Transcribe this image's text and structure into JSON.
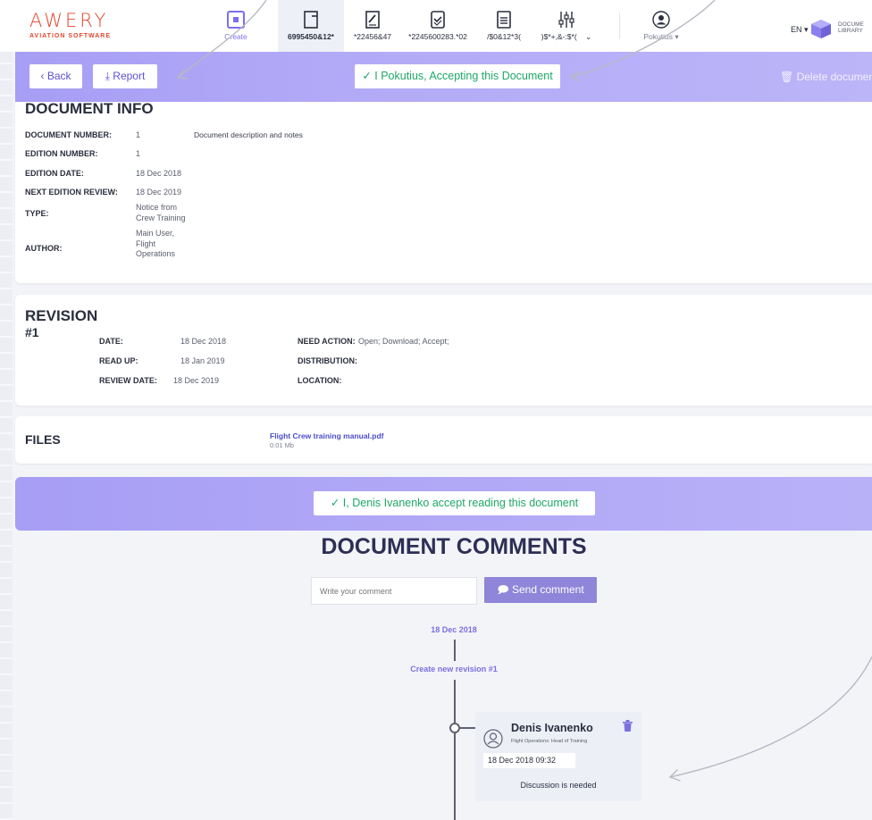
{
  "brand": {
    "name": "AWERY",
    "tagline": "AVIATION SOFTWARE",
    "accent": "#e3462c"
  },
  "nav": {
    "create_label": "Create",
    "items": [
      {
        "label": "6995450&12*",
        "icon": "document-icon"
      },
      {
        "label": "*22456&47",
        "icon": "edit-document-icon"
      },
      {
        "label": "*2245600283.*02",
        "icon": "checked-document-icon"
      },
      {
        "label": "/$0&12*3(",
        "icon": "list-document-icon"
      },
      {
        "label": ")$*+,&-:$*(",
        "icon": "sliders-icon"
      }
    ],
    "user_label": "Pokutius",
    "language": "EN",
    "library_text_line1": "DOCUME",
    "library_text_line2": "LIBRARY"
  },
  "action_bar": {
    "back_label": "Back",
    "report_label": "Report",
    "accept_label": "I Pokutius, Accepting this Document",
    "delete_label": "Delete documen"
  },
  "document_info": {
    "title": "DOCUMENT INFO",
    "description": "Document description and notes",
    "fields": [
      {
        "label": "DOCUMENT NUMBER:",
        "value": "1"
      },
      {
        "label": "EDITION NUMBER:",
        "value": "1"
      },
      {
        "label": "EDITION DATE:",
        "value": "18 Dec 2018"
      },
      {
        "label": "NEXT EDITION REVIEW:",
        "value": "18 Dec 2019"
      },
      {
        "label": "TYPE:",
        "value_lines": [
          "Notice from",
          "Crew Training"
        ]
      },
      {
        "label": "AUTHOR:",
        "value_lines": [
          "Main User,",
          "Flight",
          "Operations"
        ]
      }
    ]
  },
  "revision": {
    "title": "REVISION",
    "number": "#1",
    "date_label": "DATE:",
    "date_value": "18 Dec 2018",
    "read_up_label": "READ UP:",
    "read_up_value": "18 Jan 2019",
    "review_label": "REVIEW DATE:",
    "review_value": "18 Dec 2019",
    "need_action_label": "NEED ACTION:",
    "need_action_value": "Open; Download; Accept;",
    "distribution_label": "DISTRIBUTION:",
    "location_label": "LOCATION:"
  },
  "files": {
    "title": "FILES",
    "file_name": "Flight Crew training manual.pdf",
    "file_size": "0.01 Mb"
  },
  "read_accept_label": "I, Denis Ivanenko accept reading this document",
  "comments": {
    "title": "DOCUMENT COMMENTS",
    "input_placeholder": "Write your comment",
    "send_label": "Send comment",
    "timeline_date": "18 Dec 2018",
    "timeline_event": "Create new revision #1",
    "entry": {
      "author": "Denis Ivanenko",
      "role": "Flight Operations: Head of Training",
      "timestamp": "18 Dec 2018 09:32",
      "message": "Discussion is needed"
    }
  },
  "colors": {
    "purple_bar": "#a79ef5",
    "accept_green": "#1ea865",
    "link_purple": "#7a70e0"
  }
}
